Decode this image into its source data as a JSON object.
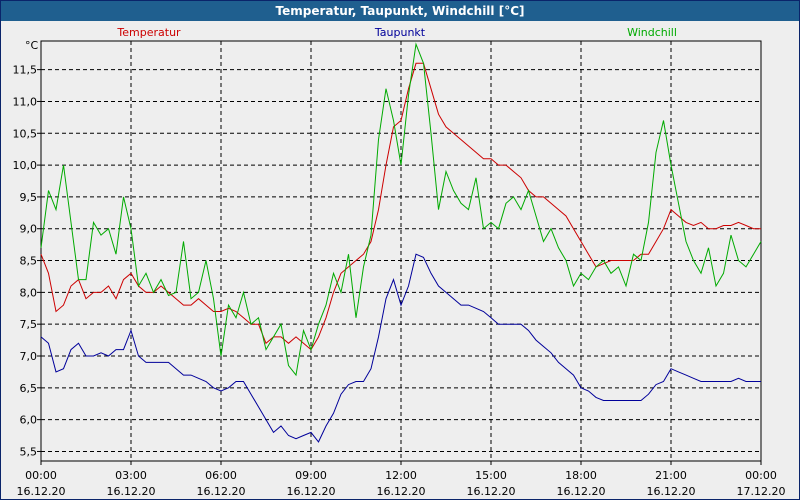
{
  "window": {
    "title": "Temperatur, Taupunkt, Windchill [°C]"
  },
  "chart_data": {
    "type": "line",
    "title": "Temperatur, Taupunkt, Windchill [°C]",
    "ylabel": "°C",
    "ylim": [
      5.35,
      11.95
    ],
    "y_ticks": [
      "5,5",
      "6,0",
      "6,5",
      "7,0",
      "7,5",
      "8,0",
      "8,5",
      "9,0",
      "9,5",
      "10,0",
      "10,5",
      "11,0",
      "11,5"
    ],
    "y_tick_values": [
      5.5,
      6.0,
      6.5,
      7.0,
      7.5,
      8.0,
      8.5,
      9.0,
      9.5,
      10.0,
      10.5,
      11.0,
      11.5
    ],
    "x_tick_times": [
      "00:00",
      "03:00",
      "06:00",
      "09:00",
      "12:00",
      "15:00",
      "18:00",
      "21:00",
      "00:00"
    ],
    "x_tick_dates": [
      "16.12.20",
      "16.12.20",
      "16.12.20",
      "16.12.20",
      "16.12.20",
      "16.12.20",
      "16.12.20",
      "16.12.20",
      "17.12.20"
    ],
    "xlim_hours": [
      0,
      24
    ],
    "grid": true,
    "legend_placement": "top",
    "series": [
      {
        "name": "Temperatur",
        "color": "#cc0000",
        "x": [
          0,
          0.25,
          0.5,
          0.75,
          1,
          1.25,
          1.5,
          1.75,
          2,
          2.25,
          2.5,
          2.75,
          3,
          3.25,
          3.5,
          3.75,
          4,
          4.25,
          4.5,
          4.75,
          5,
          5.25,
          5.5,
          5.75,
          6,
          6.25,
          6.5,
          6.75,
          7,
          7.25,
          7.5,
          7.75,
          8,
          8.25,
          8.5,
          8.75,
          9,
          9.25,
          9.5,
          9.75,
          10,
          10.25,
          10.5,
          10.75,
          11,
          11.25,
          11.5,
          11.75,
          12,
          12.25,
          12.5,
          12.75,
          13,
          13.25,
          13.5,
          13.75,
          14,
          14.25,
          14.5,
          14.75,
          15,
          15.25,
          15.5,
          15.75,
          16,
          16.25,
          16.5,
          16.75,
          17,
          17.25,
          17.5,
          17.75,
          18,
          18.25,
          18.5,
          18.75,
          19,
          19.25,
          19.5,
          19.75,
          20,
          20.25,
          20.5,
          20.75,
          21,
          21.25,
          21.5,
          21.75,
          22,
          22.25,
          22.5,
          22.75,
          23,
          23.25,
          23.5,
          23.75,
          24
        ],
        "values": [
          8.6,
          8.3,
          7.7,
          7.8,
          8.1,
          8.2,
          7.9,
          8.0,
          8.0,
          8.1,
          7.9,
          8.2,
          8.3,
          8.1,
          8.0,
          8.0,
          8.1,
          8.0,
          7.9,
          7.8,
          7.8,
          7.9,
          7.8,
          7.7,
          7.7,
          7.75,
          7.7,
          7.6,
          7.5,
          7.5,
          7.2,
          7.3,
          7.3,
          7.2,
          7.3,
          7.2,
          7.1,
          7.3,
          7.6,
          8.0,
          8.3,
          8.4,
          8.5,
          8.6,
          8.8,
          9.3,
          10.0,
          10.6,
          10.7,
          11.2,
          11.6,
          11.6,
          11.2,
          10.8,
          10.6,
          10.5,
          10.4,
          10.3,
          10.2,
          10.1,
          10.1,
          10.0,
          10.0,
          9.9,
          9.8,
          9.6,
          9.5,
          9.5,
          9.4,
          9.3,
          9.2,
          9.0,
          8.8,
          8.6,
          8.4,
          8.45,
          8.5,
          8.5,
          8.5,
          8.5,
          8.6,
          8.6,
          8.8,
          9.0,
          9.3,
          9.2,
          9.1,
          9.05,
          9.1,
          9.0,
          9.0,
          9.05,
          9.05,
          9.1,
          9.05,
          9.0,
          9.0
        ]
      },
      {
        "name": "Taupunkt",
        "color": "#00009a",
        "x": [
          0,
          0.25,
          0.5,
          0.75,
          1,
          1.25,
          1.5,
          1.75,
          2,
          2.25,
          2.5,
          2.75,
          3,
          3.25,
          3.5,
          3.75,
          4,
          4.25,
          4.5,
          4.75,
          5,
          5.25,
          5.5,
          5.75,
          6,
          6.25,
          6.5,
          6.75,
          7,
          7.25,
          7.5,
          7.75,
          8,
          8.25,
          8.5,
          8.75,
          9,
          9.25,
          9.5,
          9.75,
          10,
          10.25,
          10.5,
          10.75,
          11,
          11.25,
          11.5,
          11.75,
          12,
          12.25,
          12.5,
          12.75,
          13,
          13.25,
          13.5,
          13.75,
          14,
          14.25,
          14.5,
          14.75,
          15,
          15.25,
          15.5,
          15.75,
          16,
          16.25,
          16.5,
          16.75,
          17,
          17.25,
          17.5,
          17.75,
          18,
          18.25,
          18.5,
          18.75,
          19,
          19.25,
          19.5,
          19.75,
          20,
          20.25,
          20.5,
          20.75,
          21,
          21.25,
          21.5,
          21.75,
          22,
          22.25,
          22.5,
          22.75,
          23,
          23.25,
          23.5,
          23.75,
          24
        ],
        "values": [
          7.3,
          7.2,
          6.75,
          6.8,
          7.1,
          7.2,
          7.0,
          7.0,
          7.05,
          7.0,
          7.1,
          7.1,
          7.4,
          7.0,
          6.9,
          6.9,
          6.9,
          6.9,
          6.8,
          6.7,
          6.7,
          6.65,
          6.6,
          6.5,
          6.45,
          6.5,
          6.6,
          6.6,
          6.4,
          6.2,
          6.0,
          5.8,
          5.9,
          5.75,
          5.7,
          5.75,
          5.8,
          5.65,
          5.9,
          6.1,
          6.4,
          6.55,
          6.6,
          6.6,
          6.8,
          7.3,
          7.9,
          8.2,
          7.8,
          8.1,
          8.6,
          8.55,
          8.3,
          8.1,
          8.0,
          7.9,
          7.8,
          7.8,
          7.75,
          7.7,
          7.6,
          7.5,
          7.5,
          7.5,
          7.5,
          7.4,
          7.25,
          7.15,
          7.05,
          6.9,
          6.8,
          6.7,
          6.5,
          6.45,
          6.35,
          6.3,
          6.3,
          6.3,
          6.3,
          6.3,
          6.3,
          6.4,
          6.55,
          6.6,
          6.8,
          6.75,
          6.7,
          6.65,
          6.6,
          6.6,
          6.6,
          6.6,
          6.6,
          6.65,
          6.6,
          6.6,
          6.6
        ]
      },
      {
        "name": "Windchill",
        "color": "#00aa00",
        "x": [
          0,
          0.25,
          0.5,
          0.75,
          1,
          1.25,
          1.5,
          1.75,
          2,
          2.25,
          2.5,
          2.75,
          3,
          3.25,
          3.5,
          3.75,
          4,
          4.25,
          4.5,
          4.75,
          5,
          5.25,
          5.5,
          5.75,
          6,
          6.25,
          6.5,
          6.75,
          7,
          7.25,
          7.5,
          7.75,
          8,
          8.25,
          8.5,
          8.75,
          9,
          9.25,
          9.5,
          9.75,
          10,
          10.25,
          10.5,
          10.75,
          11,
          11.25,
          11.5,
          11.75,
          12,
          12.25,
          12.5,
          12.75,
          13,
          13.25,
          13.5,
          13.75,
          14,
          14.25,
          14.5,
          14.75,
          15,
          15.25,
          15.5,
          15.75,
          16,
          16.25,
          16.5,
          16.75,
          17,
          17.25,
          17.5,
          17.75,
          18,
          18.25,
          18.5,
          18.75,
          19,
          19.25,
          19.5,
          19.75,
          20,
          20.25,
          20.5,
          20.75,
          21,
          21.25,
          21.5,
          21.75,
          22,
          22.25,
          22.5,
          22.75,
          23,
          23.25,
          23.5,
          23.75,
          24
        ],
        "values": [
          8.7,
          9.6,
          9.3,
          10.0,
          9.1,
          8.2,
          8.2,
          9.1,
          8.9,
          9.0,
          8.6,
          9.5,
          9.0,
          8.1,
          8.3,
          8.0,
          8.2,
          7.95,
          8.0,
          8.8,
          7.9,
          8.0,
          8.5,
          7.9,
          7.0,
          7.8,
          7.6,
          8.0,
          7.5,
          7.6,
          7.1,
          7.3,
          7.5,
          6.85,
          6.7,
          7.4,
          7.1,
          7.5,
          7.8,
          8.3,
          8.0,
          8.6,
          7.6,
          8.4,
          8.9,
          10.4,
          11.2,
          10.7,
          10.0,
          11.1,
          11.9,
          11.6,
          10.5,
          9.3,
          9.9,
          9.6,
          9.4,
          9.3,
          9.8,
          9.0,
          9.1,
          9.0,
          9.4,
          9.5,
          9.3,
          9.6,
          9.2,
          8.8,
          9.0,
          8.7,
          8.5,
          8.1,
          8.3,
          8.2,
          8.4,
          8.5,
          8.3,
          8.4,
          8.1,
          8.6,
          8.5,
          9.1,
          10.2,
          10.7,
          10.0,
          9.4,
          8.8,
          8.5,
          8.3,
          8.7,
          8.1,
          8.3,
          8.9,
          8.5,
          8.4,
          8.6,
          8.8
        ]
      }
    ]
  }
}
